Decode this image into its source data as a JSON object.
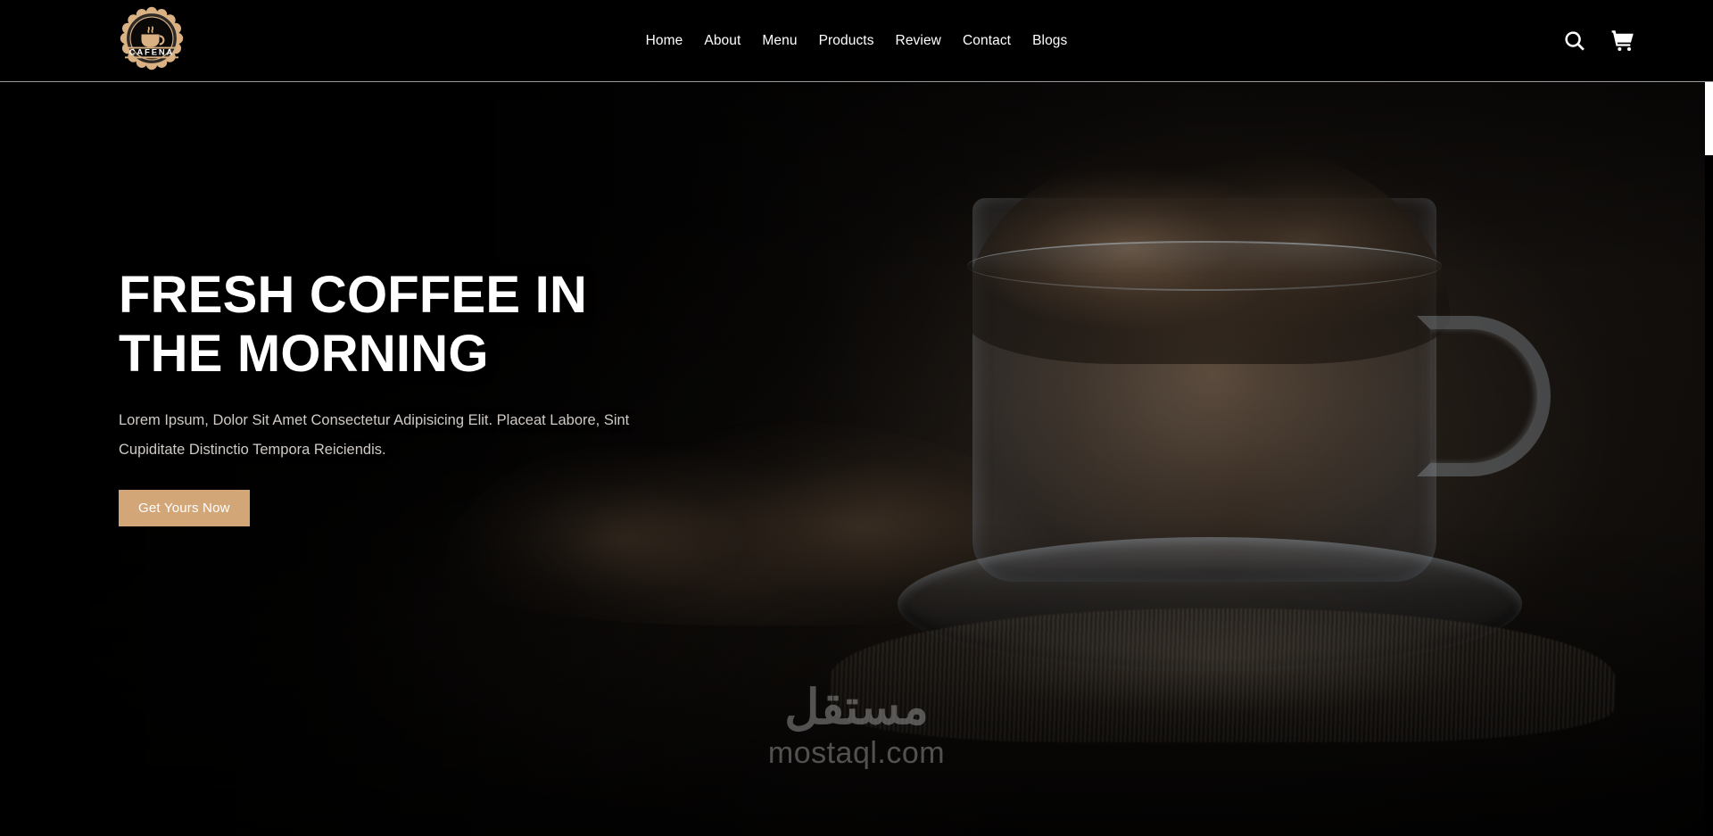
{
  "site": {
    "brand_name": "CAFENA",
    "accent_color": "#d3a678",
    "header_bg": "#000000",
    "text_color": "#ffffff"
  },
  "header": {
    "logo": {
      "name": "cafena-logo",
      "wordmark": "CAFENA",
      "icon": "coffee-cup-badge-icon",
      "badge_color": "#d9b183",
      "ring_color": "#2e2a27"
    },
    "nav": [
      {
        "label": "Home",
        "id": "home",
        "active": true
      },
      {
        "label": "About",
        "id": "about",
        "active": false
      },
      {
        "label": "Menu",
        "id": "menu",
        "active": false
      },
      {
        "label": "Products",
        "id": "products",
        "active": false
      },
      {
        "label": "Review",
        "id": "review",
        "active": false
      },
      {
        "label": "Contact",
        "id": "contact",
        "active": false
      },
      {
        "label": "Blogs",
        "id": "blogs",
        "active": false
      }
    ],
    "icons": [
      {
        "name": "search-icon",
        "label": "Search"
      },
      {
        "name": "shopping-cart-icon",
        "label": "Cart"
      }
    ]
  },
  "hero": {
    "title": "Fresh Coffee In\nThe Morning",
    "description": "Lorem Ipsum, Dolor Sit Amet Consectetur Adipisicing Elit. Placeat Labore, Sint Cupiditate Distinctio Tempora Reiciendis.",
    "cta_label": "Get Yours Now",
    "background_alt": "coffee-beans-in-glass-cup"
  },
  "watermark": {
    "arabic": "مستقل",
    "latin": "mostaql.com"
  }
}
